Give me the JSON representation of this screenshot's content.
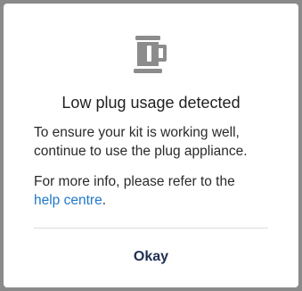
{
  "dialog": {
    "icon": "kettle-icon",
    "title": "Low plug usage detected",
    "message": "To ensure your kit is working well, continue to use the plug appliance.",
    "info_prefix": "For more info, please refer to the",
    "link_text": "help centre",
    "info_suffix": ".",
    "ok_label": "Okay"
  },
  "colors": {
    "link": "#1f78c8",
    "button_text": "#1e2f53",
    "icon": "#8c8c8c"
  }
}
